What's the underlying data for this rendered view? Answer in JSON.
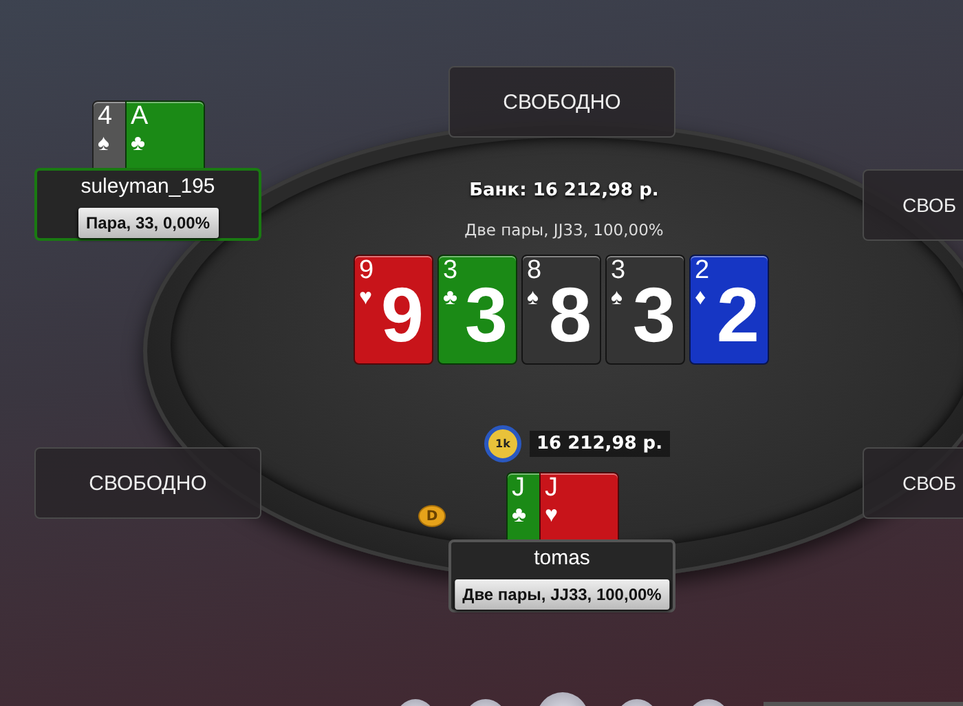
{
  "empty_seats": [
    {
      "label": "СВОБОДНО"
    },
    {
      "label": "СВОБ"
    },
    {
      "label": "СВОБОДНО"
    },
    {
      "label": "СВОБ"
    }
  ],
  "pot": {
    "label": "Банк: 16 212,98 р.",
    "hand": "Две пары, JJ33, 100,00%"
  },
  "board": [
    {
      "rank": "9",
      "suit": "♥",
      "face": "9",
      "color": "#c8141a"
    },
    {
      "rank": "3",
      "suit": "♣",
      "face": "3",
      "color": "#1b8a16"
    },
    {
      "rank": "8",
      "suit": "♠",
      "face": "8",
      "color": "#343434"
    },
    {
      "rank": "3",
      "suit": "♠",
      "face": "3",
      "color": "#343434"
    },
    {
      "rank": "2",
      "suit": "♦",
      "face": "2",
      "color": "#1636c4"
    }
  ],
  "players": [
    {
      "name": "suleyman_195",
      "hand": "Пара, 33, 0,00%",
      "highlighted": true,
      "cards": [
        {
          "rank": "4",
          "suit": "♠",
          "color": "#555555"
        },
        {
          "rank": "A",
          "suit": "♣",
          "color": "#1b8a16"
        }
      ]
    },
    {
      "name": "tomas",
      "hand": "Две пары, JJ33, 100,00%",
      "highlighted": false,
      "dealer_button": "D",
      "cards": [
        {
          "rank": "J",
          "suit": "♣",
          "color": "#1b8a16"
        },
        {
          "rank": "J",
          "suit": "♥",
          "color": "#c8141a"
        }
      ]
    }
  ],
  "bet": {
    "chip": "1k",
    "amount": "16 212,98 р."
  }
}
